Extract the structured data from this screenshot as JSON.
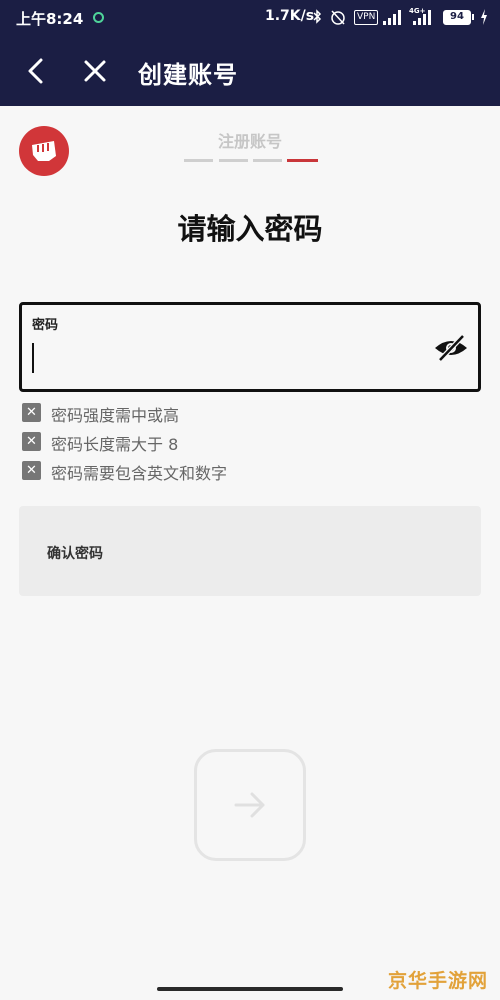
{
  "status_bar": {
    "time": "上午8:24",
    "network_speed": "1.7K/s",
    "vpn": "VPN",
    "signal2_label": "4G+",
    "battery": "94",
    "icons": [
      "bluetooth-icon",
      "alarm-off-icon",
      "signal-icon",
      "battery-icon",
      "charging-icon"
    ]
  },
  "app_bar": {
    "title": "创建账号",
    "back_icon": "chevron-left-icon",
    "close_icon": "close-icon"
  },
  "progress": {
    "label": "注册账号",
    "total_steps": 4,
    "current_step": 4
  },
  "main": {
    "heading": "请输入密码",
    "password_field": {
      "label": "密码",
      "value": "",
      "toggle_icon": "eye-off-icon"
    },
    "rules": [
      {
        "text": "密码强度需中或高",
        "met": false
      },
      {
        "text": "密码长度需大于 8",
        "met": false
      },
      {
        "text": "密码需要包含英文和数字",
        "met": false
      }
    ],
    "confirm_field": {
      "label": "确认密码",
      "value": ""
    },
    "next_button_icon": "arrow-right-icon"
  },
  "watermark": "京华手游网",
  "colors": {
    "header_bg": "#1b1e44",
    "accent_red": "#c9363a",
    "logo_red": "#d13639"
  }
}
